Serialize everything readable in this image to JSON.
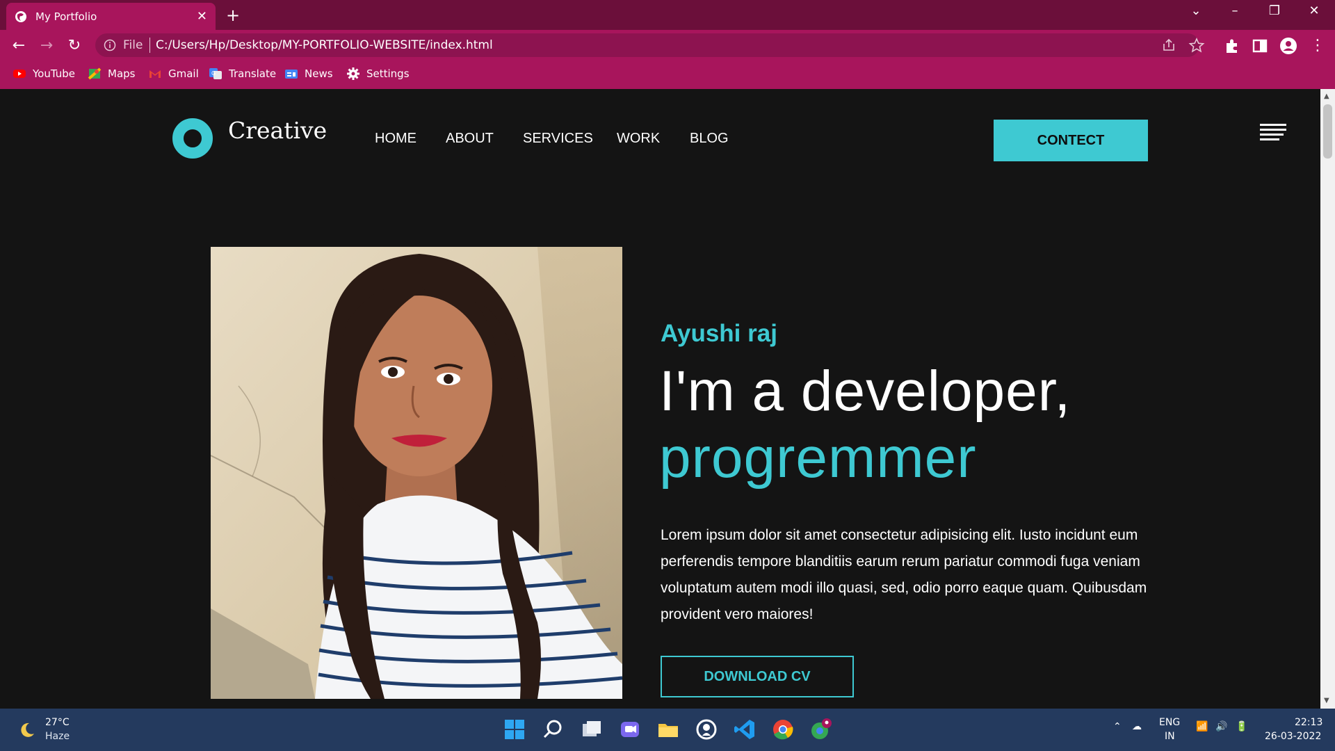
{
  "browser": {
    "tab_title": "My Portfolio",
    "tab_close": "✕",
    "new_tab": "+",
    "address_file_label": "File",
    "address_url": "C:/Users/Hp/Desktop/MY-PORTFOLIO-WEBSITE/index.html",
    "bookmarks": [
      {
        "label": "YouTube",
        "icon": "youtube-icon"
      },
      {
        "label": "Maps",
        "icon": "maps-icon"
      },
      {
        "label": "Gmail",
        "icon": "gmail-icon"
      },
      {
        "label": "Translate",
        "icon": "translate-icon"
      },
      {
        "label": "News",
        "icon": "news-icon"
      },
      {
        "label": "Settings",
        "icon": "gear-icon"
      }
    ],
    "theme_color": "#a8155c"
  },
  "site": {
    "logo_text": "Creative",
    "nav": [
      "HOME",
      "ABOUT",
      "SERVICES",
      "WORK",
      "BLOG"
    ],
    "contact_button": "CONTECT",
    "accent_color": "#3ec9d2"
  },
  "hero": {
    "name": "Ayushi raj",
    "line1": "I'm a developer,",
    "line2": "progremmer",
    "description": "Lorem ipsum dolor sit amet consectetur adipisicing elit. Iusto incidunt eum perferendis tempore blanditiis earum rerum pariatur commodi fuga veniam voluptatum autem modi illo quasi, sed, odio porro eaque quam. Quibusdam provident vero maiores!",
    "download_button": "DOWNLOAD CV"
  },
  "taskbar": {
    "weather_temp": "27°C",
    "weather_condition": "Haze",
    "language_line1": "ENG",
    "language_line2": "IN",
    "time": "22:13",
    "date": "26-03-2022"
  }
}
